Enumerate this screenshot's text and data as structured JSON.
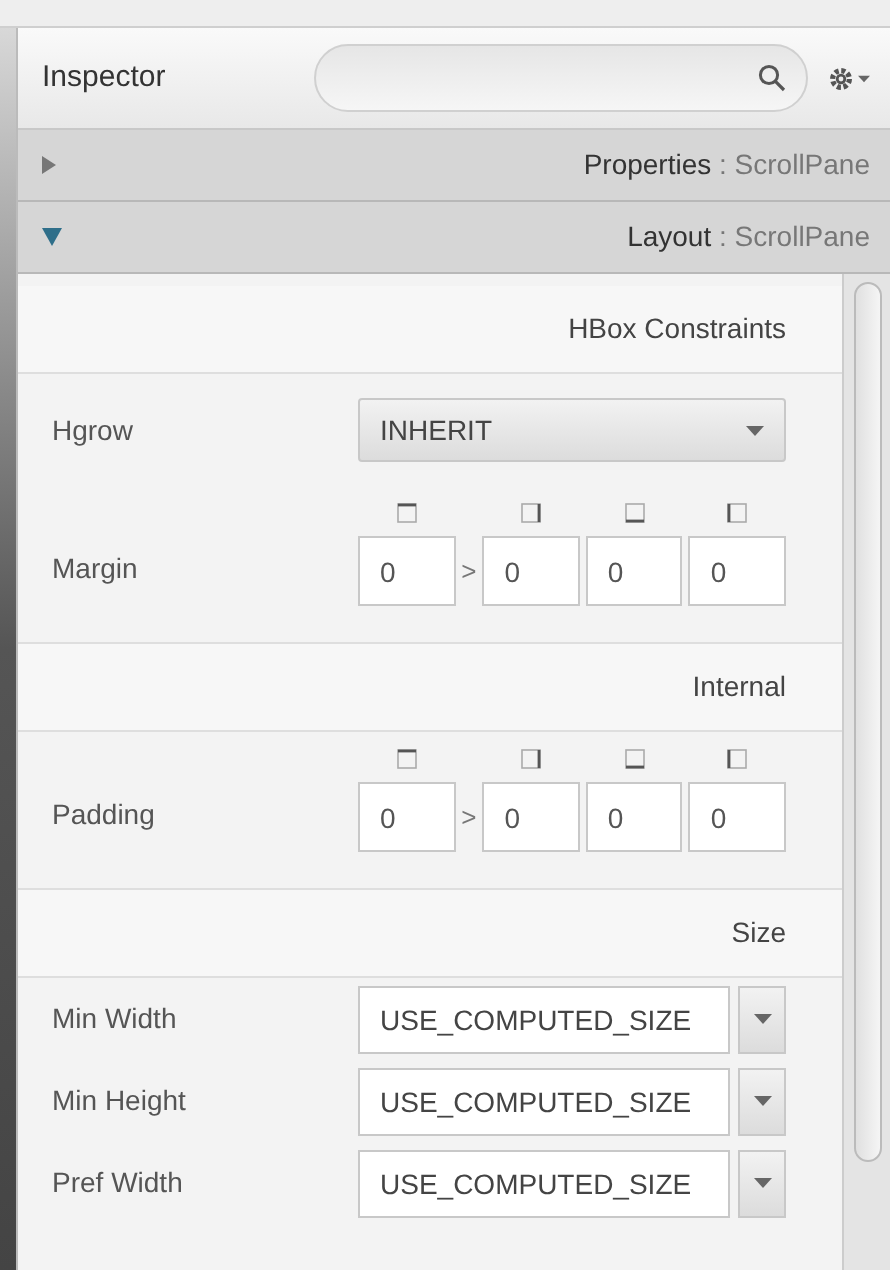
{
  "inspector": {
    "title": "Inspector"
  },
  "panes": [
    {
      "name": "Properties",
      "separator": ":",
      "type": "ScrollPane",
      "expanded": false
    },
    {
      "name": "Layout",
      "separator": ":",
      "type": "ScrollPane",
      "expanded": true
    }
  ],
  "rows": [
    {
      "kind": "header",
      "text": "HBox Constraints"
    },
    {
      "kind": "choice",
      "label": "Hgrow",
      "value": "INHERIT"
    },
    {
      "kind": "insets",
      "label": "Margin",
      "values": [
        "0",
        "0",
        "0",
        "0"
      ],
      "link": ">"
    },
    {
      "kind": "header",
      "text": "Internal"
    },
    {
      "kind": "insets",
      "label": "Padding",
      "values": [
        "0",
        "0",
        "0",
        "0"
      ],
      "link": ">"
    },
    {
      "kind": "header",
      "text": "Size"
    },
    {
      "kind": "size",
      "label": "Min Width",
      "value": "USE_COMPUTED_SIZE"
    },
    {
      "kind": "size",
      "label": "Min Height",
      "value": "USE_COMPUTED_SIZE"
    },
    {
      "kind": "size",
      "label": "Pref Width",
      "value": "USE_COMPUTED_SIZE"
    }
  ]
}
